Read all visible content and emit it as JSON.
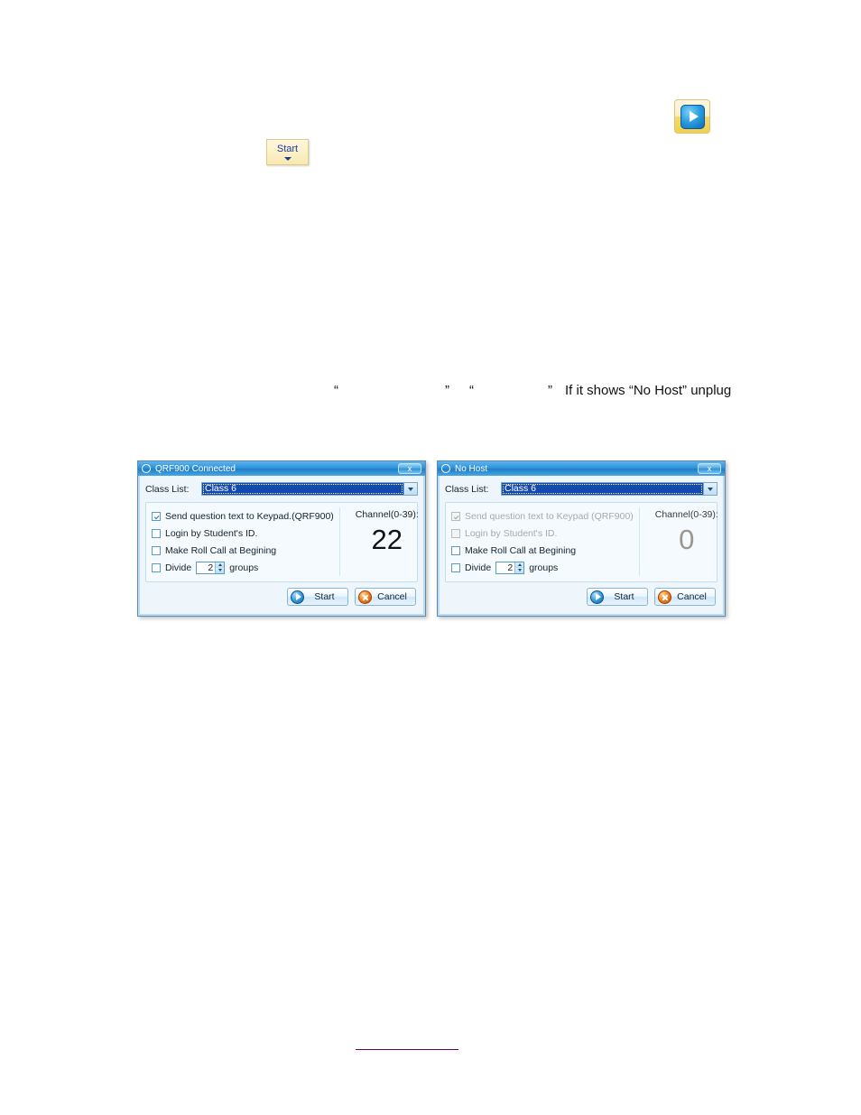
{
  "page": {
    "toolbar_play_icon": "play-icon",
    "start_menu_button": {
      "label": "Start",
      "caret_icon": "caret-down-icon"
    },
    "paragraph": {
      "open_quote_1": "“",
      "close_quote_1": "”",
      "open_quote_2": "“",
      "close_quote_2": "”",
      "tail_text": "If it shows “No Host” unplug"
    },
    "footer_link_text": ""
  },
  "dialogs": [
    {
      "id": "qrf900-connected",
      "title": "QRF900 Connected",
      "title_icon": "app-circle-icon",
      "close_label": "x",
      "class_list": {
        "label": "Class List:",
        "value": "Class 6",
        "arrow_icon": "chevron-down-icon"
      },
      "options": [
        {
          "label": "Send question text to Keypad.(QRF900)",
          "checked": true,
          "disabled": false
        },
        {
          "label": "Login by Student's ID.",
          "checked": false,
          "disabled": false
        },
        {
          "label": "Make Roll Call at Begining",
          "checked": false,
          "disabled": false
        }
      ],
      "divide": {
        "label": "Divide",
        "value": "2",
        "suffix": "groups",
        "checked": false,
        "disabled": false,
        "up_icon": "spinner-up-icon",
        "down_icon": "spinner-down-icon"
      },
      "channel": {
        "label": "Channel(0-39):",
        "value": "22",
        "disabled": false
      },
      "buttons": {
        "start": {
          "label": "Start",
          "icon": "play-icon"
        },
        "cancel": {
          "label": "Cancel",
          "icon": "cancel-x-icon"
        }
      }
    },
    {
      "id": "no-host",
      "title": "No Host",
      "title_icon": "app-circle-icon",
      "close_label": "x",
      "class_list": {
        "label": "Class List:",
        "value": "Class 6",
        "arrow_icon": "chevron-down-icon"
      },
      "options": [
        {
          "label": "Send question text to Keypad (QRF900)",
          "checked": true,
          "disabled": true
        },
        {
          "label": "Login by Student's ID.",
          "checked": false,
          "disabled": true
        },
        {
          "label": "Make Roll Call at Begining",
          "checked": false,
          "disabled": false
        }
      ],
      "divide": {
        "label": "Divide",
        "value": "2",
        "suffix": "groups",
        "checked": false,
        "disabled": false,
        "up_icon": "spinner-up-icon",
        "down_icon": "spinner-down-icon"
      },
      "channel": {
        "label": "Channel(0-39):",
        "value": "0",
        "disabled": true
      },
      "buttons": {
        "start": {
          "label": "Start",
          "icon": "play-icon"
        },
        "cancel": {
          "label": "Cancel",
          "icon": "cancel-x-icon"
        }
      }
    }
  ],
  "colors": {
    "titlebar_blue": "#2f93dc",
    "combo_select_blue": "#1449b0",
    "toolbar_yellow": "#f3cf4c",
    "link_purple": "#660066",
    "cancel_orange": "#f08a1c"
  }
}
